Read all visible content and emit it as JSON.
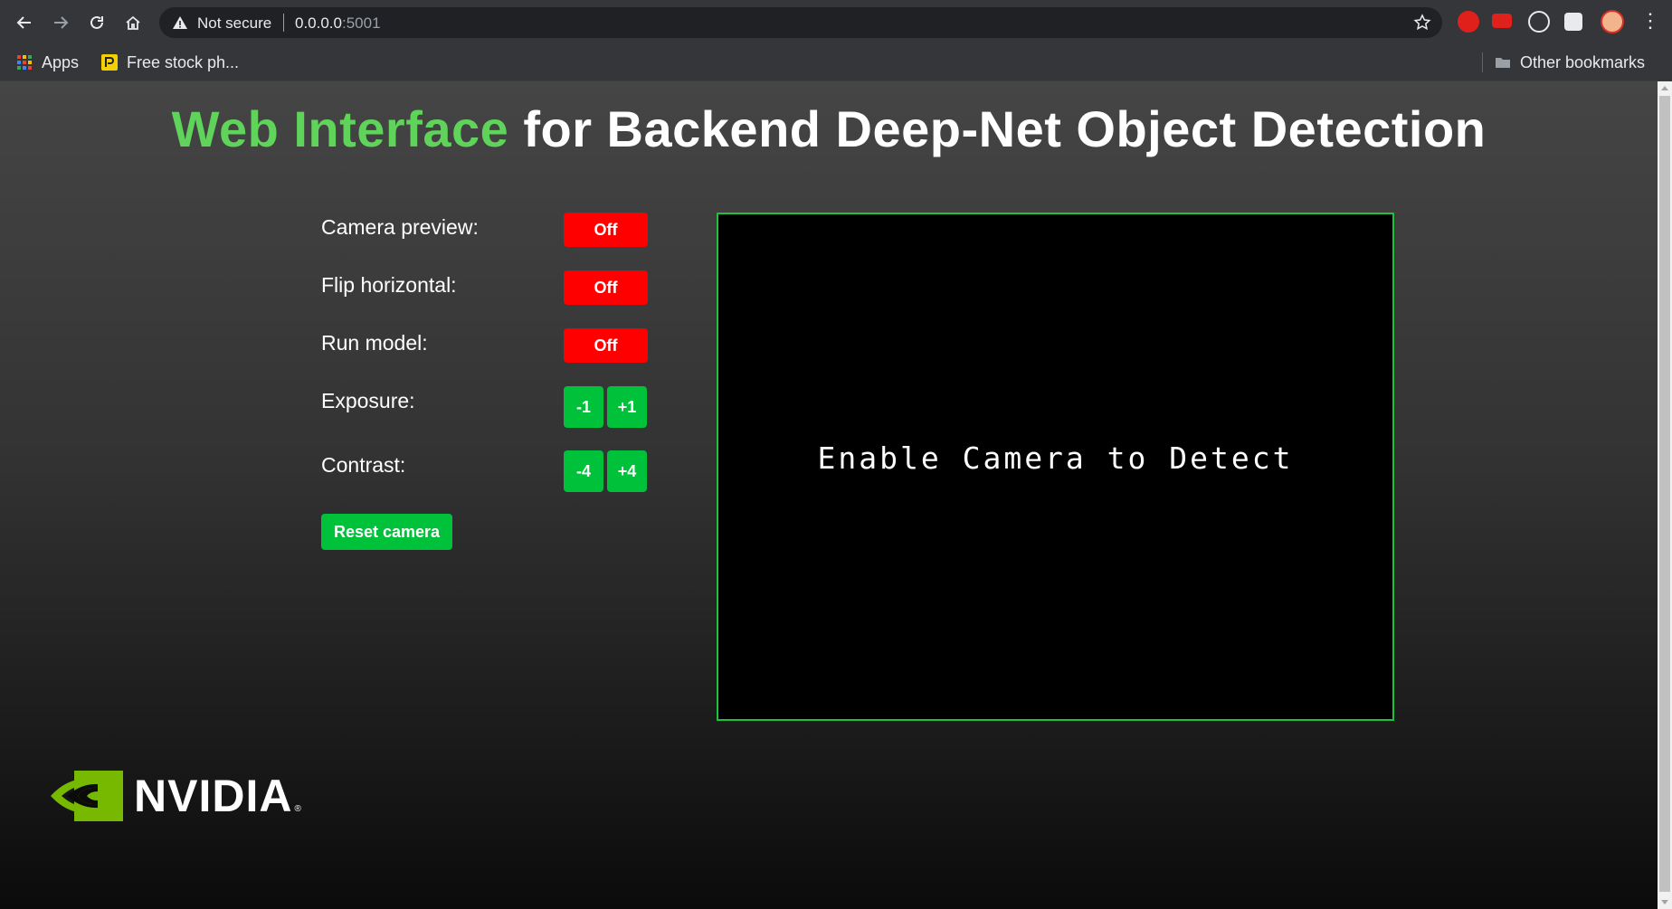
{
  "browser": {
    "security_label": "Not secure",
    "url_host": "0.0.0.0",
    "url_port": ":5001",
    "bookmarks": [
      {
        "label": "Apps",
        "icon": "apps-grid-icon"
      },
      {
        "label": "Free stock ph...",
        "icon": "pexels-icon"
      }
    ],
    "other_bookmarks": "Other bookmarks"
  },
  "page": {
    "title_accent": "Web Interface",
    "title_rest": " for Backend Deep-Net Object Detection",
    "accent_color": "#5fd35a",
    "controls": {
      "camera_preview": {
        "label": "Camera preview:",
        "state": "Off"
      },
      "flip_horizontal": {
        "label": "Flip horizontal:",
        "state": "Off"
      },
      "run_model": {
        "label": "Run model:",
        "state": "Off"
      },
      "exposure": {
        "label": "Exposure:",
        "minus": "-1",
        "plus": "+1"
      },
      "contrast": {
        "label": "Contrast:",
        "minus": "-4",
        "plus": "+4"
      },
      "reset": "Reset camera"
    },
    "preview_message": "Enable Camera to Detect",
    "logo_text": "NVIDIA",
    "logo_reg": "®"
  },
  "colors": {
    "off_button": "#ff0000",
    "on_button": "#00c23a",
    "preview_border": "#1ec23a"
  }
}
